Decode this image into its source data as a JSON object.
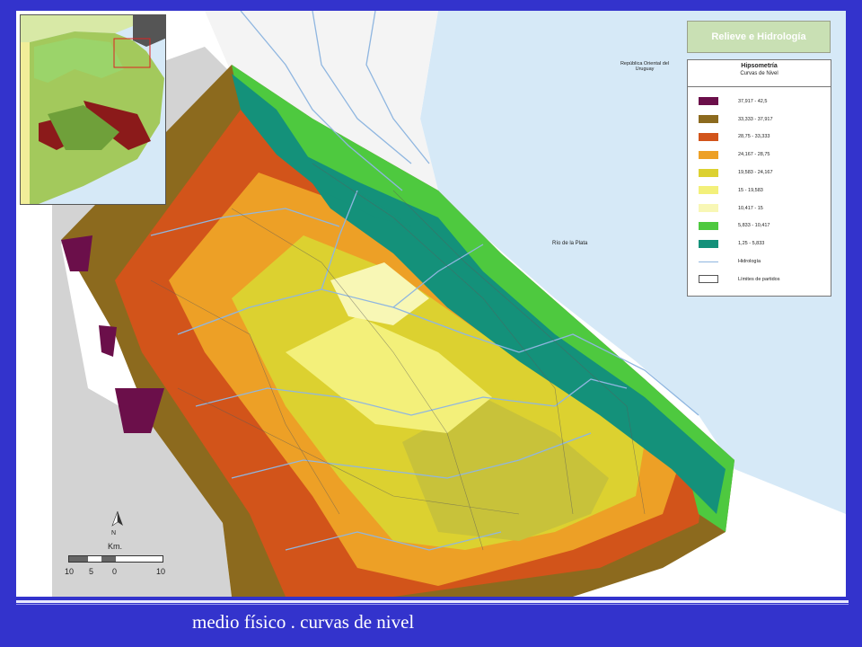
{
  "title": "Relieve e Hidrología",
  "legend": {
    "title": "Hipsometría",
    "subtitle": "Curvas de Nivel",
    "items": [
      {
        "label": "37,917 - 42,5",
        "color": "#6b0f4a",
        "kind": "swatch"
      },
      {
        "label": "33,333 - 37,917",
        "color": "#8c6a1e",
        "kind": "swatch"
      },
      {
        "label": "28,75 - 33,333",
        "color": "#d2541a",
        "kind": "swatch"
      },
      {
        "label": "24,167 - 28,75",
        "color": "#eda026",
        "kind": "swatch"
      },
      {
        "label": "19,583 - 24,167",
        "color": "#dcd130",
        "kind": "swatch"
      },
      {
        "label": "15 - 19,583",
        "color": "#f3f07a",
        "kind": "swatch"
      },
      {
        "label": "10,417 - 15",
        "color": "#f8f7b5",
        "kind": "swatch"
      },
      {
        "label": "5,833 - 10,417",
        "color": "#4ec93f",
        "kind": "swatch"
      },
      {
        "label": "1,25 - 5,833",
        "color": "#14917a",
        "kind": "swatch"
      },
      {
        "label": "Hidrología",
        "color": "#8fb6e0",
        "kind": "line"
      },
      {
        "label": "Límites de partidos",
        "color": "#555555",
        "kind": "outline"
      }
    ]
  },
  "map_labels": {
    "river": "Río de la Plata",
    "uruguay": "República Oriental del Uruguay"
  },
  "scale": {
    "unit": "Km.",
    "north": "N",
    "ticks": [
      "10",
      "5",
      "0",
      "10"
    ]
  },
  "caption": "medio físico . curvas de nivel",
  "colors": {
    "background": "#3333cc",
    "water": "#d6e9f7",
    "river_lines": "#8fb6e0"
  }
}
